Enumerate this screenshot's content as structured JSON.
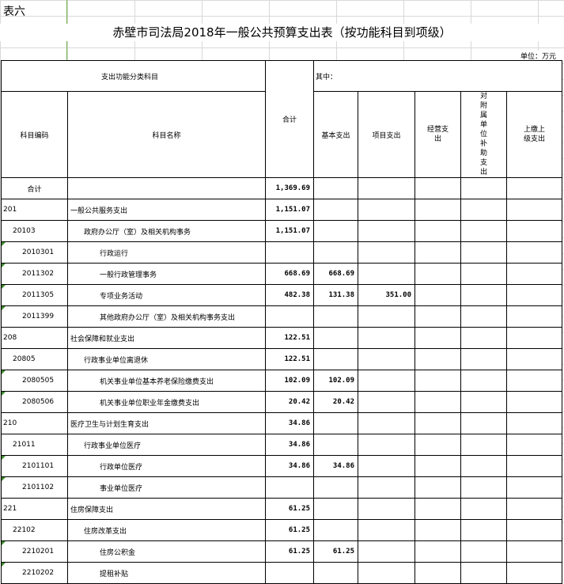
{
  "sheet_label": "表六",
  "title": "赤壁市司法局2018年一般公共预算支出表（按功能科目到项级）",
  "unit": "单位：万元",
  "header": {
    "category": "支出功能分类科目",
    "total": "合计",
    "of_which": "其中：",
    "code": "科目编码",
    "name": "科目名称",
    "basic": "基本支出",
    "project": "项目支出",
    "operating": "经营支出",
    "subsidy": "对附属单位补助支出",
    "upper": "上缴上级支出"
  },
  "rows": [
    {
      "code": "合计",
      "name": "",
      "total": "1,369.69",
      "basic": "",
      "project": "",
      "level": -1
    },
    {
      "code": "201",
      "name": "一般公共服务支出",
      "total": "1,151.07",
      "basic": "",
      "project": "",
      "level": 0
    },
    {
      "code": "20103",
      "name": "政府办公厅（室）及相关机构事务",
      "total": "1,151.07",
      "basic": "",
      "project": "",
      "level": 1
    },
    {
      "code": "2010301",
      "name": "行政运行",
      "total": "",
      "basic": "",
      "project": "",
      "level": 2
    },
    {
      "code": "2011302",
      "name": "一般行政管理事务",
      "total": "668.69",
      "basic": "668.69",
      "project": "",
      "level": 2
    },
    {
      "code": "2011305",
      "name": "专项业务活动",
      "total": "482.38",
      "basic": "131.38",
      "project": "351.00",
      "level": 2
    },
    {
      "code": "2011399",
      "name": "其他政府办公厅（室）及相关机构事务支出",
      "total": "",
      "basic": "",
      "project": "",
      "level": 2
    },
    {
      "code": "208",
      "name": "社会保障和就业支出",
      "total": "122.51",
      "basic": "",
      "project": "",
      "level": 0
    },
    {
      "code": "20805",
      "name": "行政事业单位离退休",
      "total": "122.51",
      "basic": "",
      "project": "",
      "level": 1
    },
    {
      "code": "2080505",
      "name": "机关事业单位基本养老保险缴费支出",
      "total": "102.09",
      "basic": "102.09",
      "project": "",
      "level": 2
    },
    {
      "code": "2080506",
      "name": "机关事业单位职业年金缴费支出",
      "total": "20.42",
      "basic": "20.42",
      "project": "",
      "level": 2
    },
    {
      "code": "210",
      "name": "医疗卫生与计划生育支出",
      "total": "34.86",
      "basic": "",
      "project": "",
      "level": 0
    },
    {
      "code": "21011",
      "name": "行政事业单位医疗",
      "total": "34.86",
      "basic": "",
      "project": "",
      "level": 1
    },
    {
      "code": "2101101",
      "name": "行政单位医疗",
      "total": "34.86",
      "basic": "34.86",
      "project": "",
      "level": 2
    },
    {
      "code": "2101102",
      "name": "事业单位医疗",
      "total": "",
      "basic": "",
      "project": "",
      "level": 2
    },
    {
      "code": "221",
      "name": "住房保障支出",
      "total": "61.25",
      "basic": "",
      "project": "",
      "level": 0
    },
    {
      "code": "22102",
      "name": "住房改革支出",
      "total": "61.25",
      "basic": "",
      "project": "",
      "level": 1
    },
    {
      "code": "2210201",
      "name": "住房公积金",
      "total": "61.25",
      "basic": "61.25",
      "project": "",
      "level": 2
    },
    {
      "code": "2210202",
      "name": "提租补贴",
      "total": "",
      "basic": "",
      "project": "",
      "level": 2
    }
  ]
}
